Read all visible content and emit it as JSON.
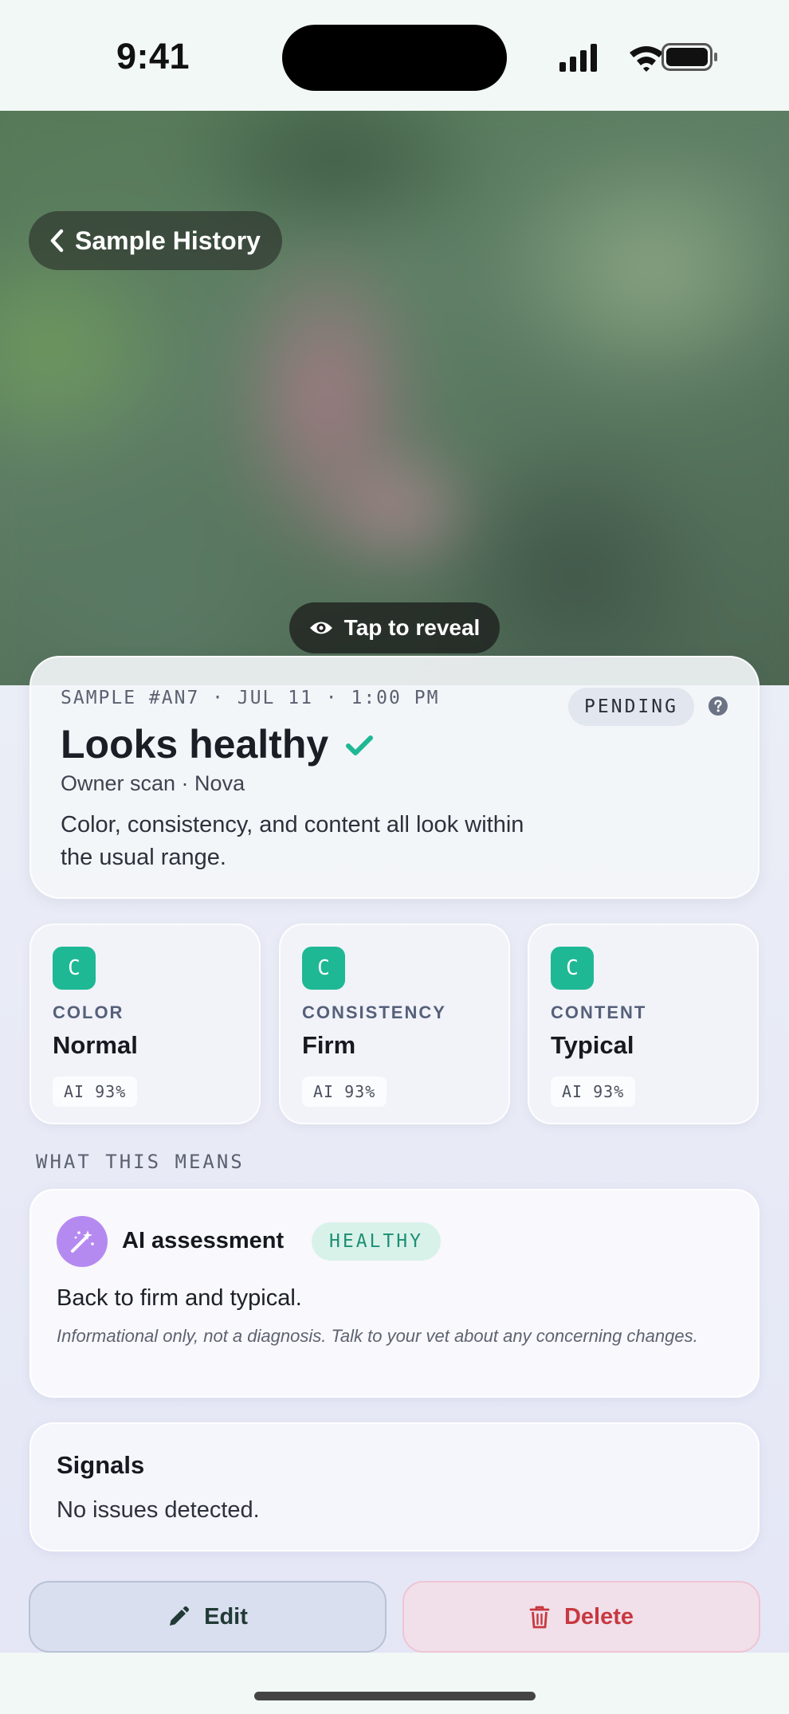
{
  "status_bar": {
    "time": "9:41"
  },
  "hero": {
    "back_label": "Sample History",
    "reveal_label": "Tap to reveal"
  },
  "summary": {
    "meta": "SAMPLE #AN7 · JUL 11 · 1:00 PM",
    "status_badge": "PENDING",
    "title": "Looks healthy",
    "subtitle": "Owner scan · Nova",
    "description": "Color, consistency, and content all look within the usual range."
  },
  "metrics": [
    {
      "grade": "C",
      "label": "COLOR",
      "value": "Normal",
      "ai": "AI 93%"
    },
    {
      "grade": "C",
      "label": "CONSISTENCY",
      "value": "Firm",
      "ai": "AI 93%"
    },
    {
      "grade": "C",
      "label": "CONTENT",
      "value": "Typical",
      "ai": "AI 93%"
    }
  ],
  "section_label": "WHAT THIS MEANS",
  "assessment": {
    "title": "AI assessment",
    "badge": "HEALTHY",
    "text": "Back to firm and typical.",
    "note": "Informational only, not a diagnosis. Talk to your vet about any concerning changes."
  },
  "signals": {
    "title": "Signals",
    "text": "No issues detected."
  },
  "actions": {
    "edit_label": "Edit",
    "delete_label": "Delete"
  },
  "colors": {
    "accent_green": "#1fb894",
    "healthy_badge_bg": "#d8f2ea",
    "wand_purple": "#b58af0",
    "delete_red": "#c8383f"
  },
  "icons": {
    "back": "chevron-left-icon",
    "reveal": "eye-icon",
    "check": "check-icon",
    "help": "question-circle-icon",
    "assessment": "magic-wand-icon",
    "edit": "pencil-icon",
    "delete": "trash-icon"
  }
}
